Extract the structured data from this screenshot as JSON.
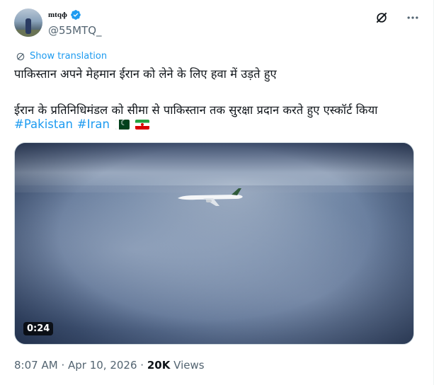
{
  "author": {
    "display_name": "mtqɸ",
    "handle": "@55MTQ_"
  },
  "icons": {
    "verified": "verified-badge-icon",
    "grok": "grok-icon",
    "more": "more-options-icon",
    "translate": "translate-icon"
  },
  "tweet": {
    "show_translation": "Show translation",
    "line1": "पाकिस्तान अपने मेहमान ईरान को लेने के लिए हवा में उड़ते हुए",
    "line2": "ईरान के प्रतिनिधिमंडल को सीमा से पाकिस्तान तक सुरक्षा प्रदान करते हुए एस्कॉर्ट किया",
    "hashtags": [
      "#Pakistan",
      "#Iran"
    ],
    "flags": [
      "pakistan-flag-icon",
      "iran-flag-icon"
    ]
  },
  "media": {
    "duration": "0:24"
  },
  "meta": {
    "time": "8:07 AM",
    "separator": "·",
    "date": "Apr 10, 2026",
    "views_count": "20K",
    "views_label": "Views"
  },
  "colors": {
    "link": "#1d9bf0",
    "text": "#0f1419",
    "secondary": "#536471",
    "verified": "#1d9bf0"
  }
}
